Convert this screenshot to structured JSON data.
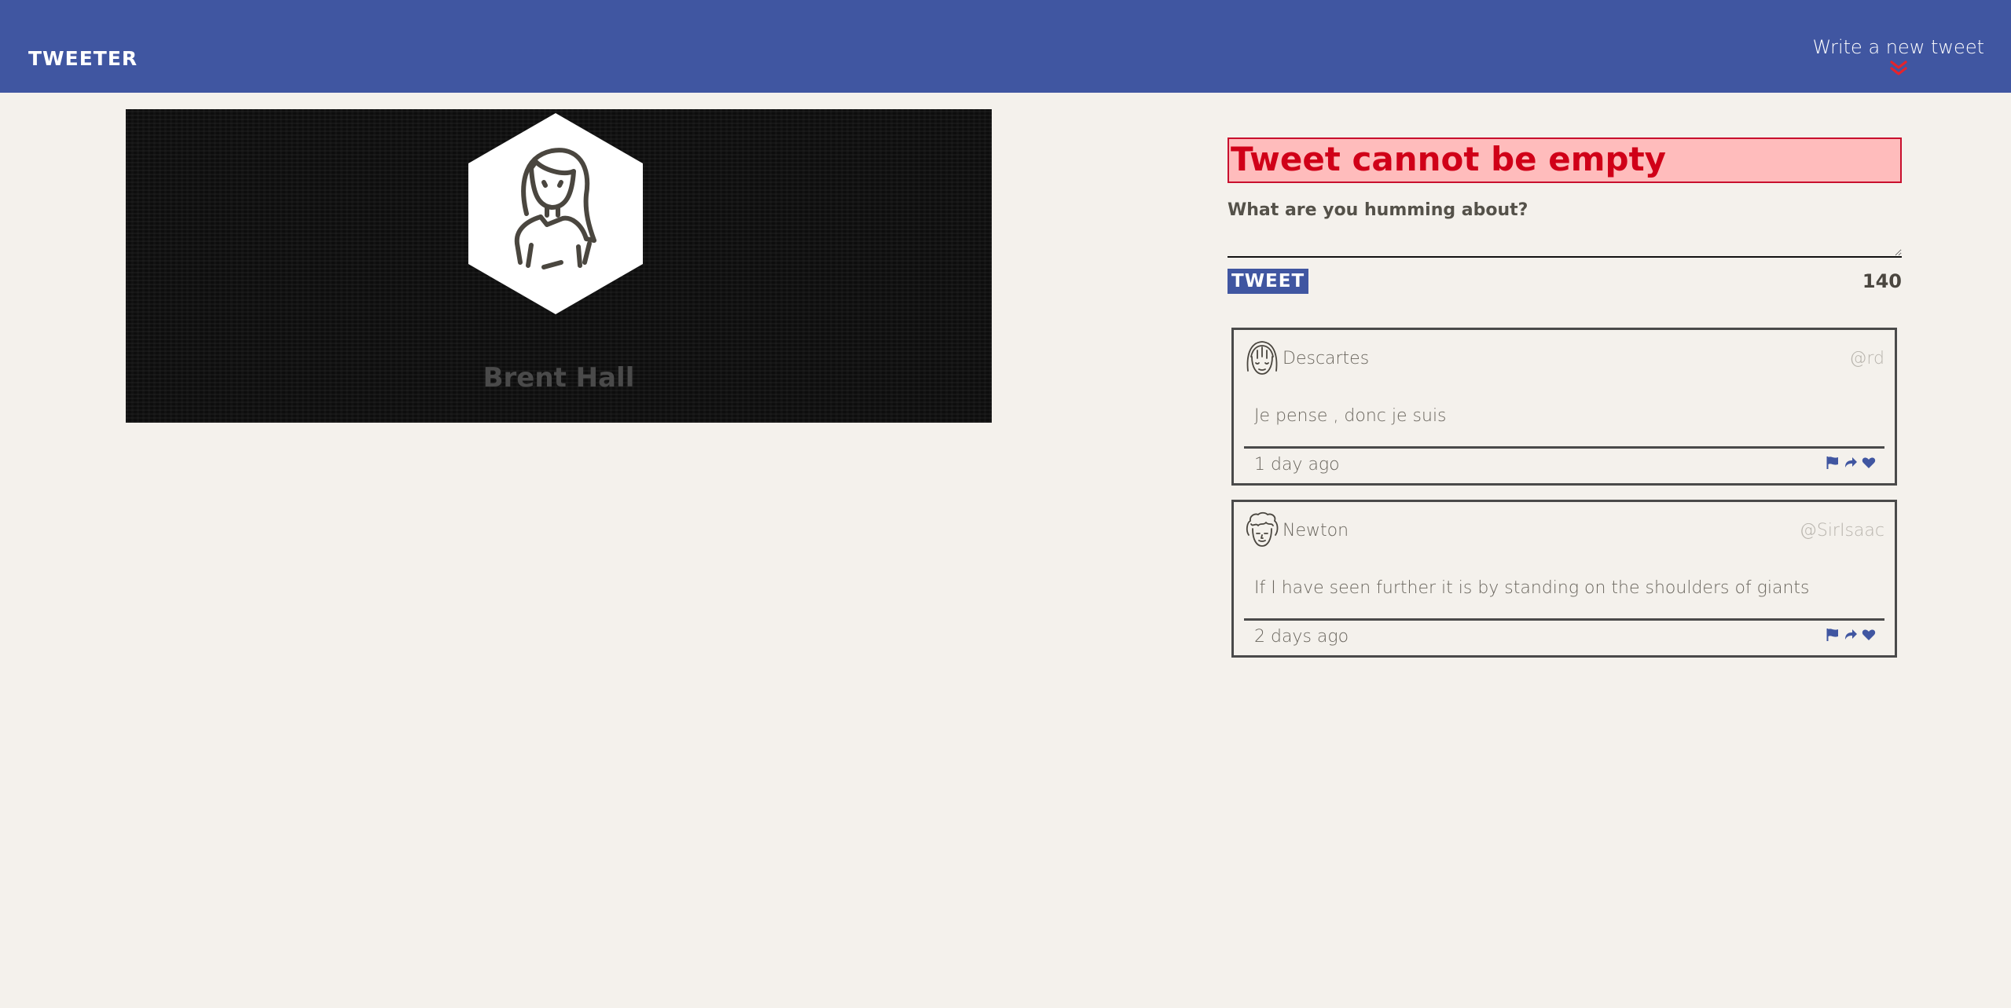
{
  "nav": {
    "brand": "TWEETER",
    "compose_toggle_label": "Write a new tweet",
    "toggle_icon": "double-chevron-down-icon",
    "toggle_icon_color": "#e4242c",
    "bg_color": "#4056a1"
  },
  "profile": {
    "name": "Brent Hall",
    "avatar_icon": "woman-avatar-icon"
  },
  "composer": {
    "error_message": "Tweet cannot be empty",
    "error_bg_color": "#ffbcbc",
    "error_text_color": "#d00018",
    "prompt": "What are you humming about?",
    "input_value": "",
    "button_label": "TWEET",
    "char_counter": "140"
  },
  "tweets": [
    {
      "name": "Descartes",
      "handle": "@rd",
      "text": "Je pense , donc je suis",
      "time": "1 day ago",
      "avatar_icon": "descartes-avatar-icon",
      "actions": [
        "flag-icon",
        "retweet-icon",
        "heart-icon"
      ]
    },
    {
      "name": "Newton",
      "handle": "@SirIsaac",
      "text": "If I have seen further it is by standing on the shoulders of giants",
      "time": "2 days ago",
      "avatar_icon": "newton-avatar-icon",
      "actions": [
        "flag-icon",
        "retweet-icon",
        "heart-icon"
      ]
    }
  ],
  "colors": {
    "page_bg": "#f4f1ec",
    "accent": "#4056a1",
    "text": "#4a463f"
  }
}
